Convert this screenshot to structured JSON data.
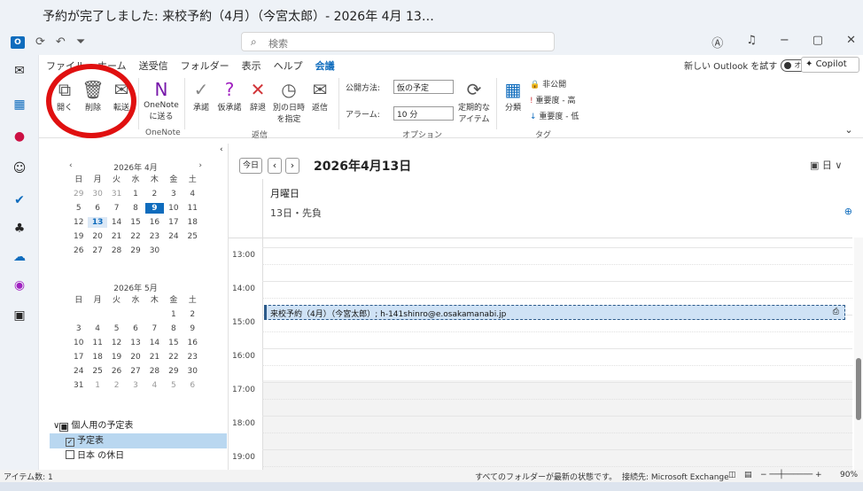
{
  "window": {
    "title": "予約が完了しました: 来校予約（4月）（今宮太郎）- 2026年 4月 13…",
    "search_placeholder": "検索"
  },
  "tabs": [
    "ファイル",
    "ホーム",
    "送受信",
    "フォルダー",
    "表示",
    "ヘルプ",
    "会議"
  ],
  "active_tab": "会議",
  "top_right": {
    "try_outlook": "新しい Outlook を試す",
    "toggle": "オフ",
    "copilot": "Copilot"
  },
  "ribbon": {
    "open": "開く",
    "delete": "削除",
    "forward": "転送",
    "onenote_send": "OneNote に送る",
    "onenote_group": "OneNote",
    "accept": "承諾",
    "tentative": "仮承諾",
    "decline": "辞退",
    "propose": "別の日時を指定",
    "reply": "返信",
    "respond_group": "返信",
    "show_as_label": "公開方法:",
    "show_as_value": "仮の予定",
    "reminder_label": "アラーム:",
    "reminder_value": "10 分",
    "recurring": "定期的なアイテム",
    "options_group": "オプション",
    "categorize": "分類",
    "private": "非公開",
    "high_importance": "重要度 - 高",
    "low_importance": "重要度 - 低",
    "tags_group": "タグ"
  },
  "mini_cal_april": {
    "title": "2026年 4月",
    "headers": [
      "日",
      "月",
      "火",
      "水",
      "木",
      "金",
      "土"
    ],
    "days": [
      "29",
      "30",
      "31",
      "1",
      "2",
      "3",
      "4",
      "5",
      "6",
      "7",
      "8",
      "9",
      "10",
      "11",
      "12",
      "13",
      "14",
      "15",
      "16",
      "17",
      "18",
      "19",
      "20",
      "21",
      "22",
      "23",
      "24",
      "25",
      "26",
      "27",
      "28",
      "29",
      "30"
    ]
  },
  "mini_cal_may": {
    "title": "2026年 5月",
    "headers": [
      "日",
      "月",
      "火",
      "水",
      "木",
      "金",
      "土"
    ],
    "days": [
      "1",
      "2",
      "3",
      "4",
      "5",
      "6",
      "7",
      "8",
      "9",
      "10",
      "11",
      "12",
      "13",
      "14",
      "15",
      "16",
      "17",
      "18",
      "19",
      "20",
      "21",
      "22",
      "23",
      "24",
      "25",
      "26",
      "27",
      "28",
      "29",
      "30",
      "31",
      "1",
      "2",
      "3",
      "4",
      "5",
      "6"
    ]
  },
  "calendar_list": {
    "group": "個人用の予定表",
    "items": [
      "予定表",
      "日本 の休日"
    ]
  },
  "main": {
    "today": "今日",
    "date_title": "2026年4月13日",
    "view": "日",
    "day_name": "月曜日",
    "day_sub": "13日・先負",
    "times": [
      "13:00",
      "14:00",
      "15:00",
      "16:00",
      "17:00",
      "18:00",
      "19:00"
    ],
    "event": "来校予約（4月）（今宮太郎）; h-141shinro@e.osakamanabi.jp"
  },
  "status": {
    "items": "アイテム数: 1",
    "sync": "すべてのフォルダーが最新の状態です。",
    "connection": "接続先: Microsoft Exchange",
    "zoom": "90%"
  },
  "colors": {
    "accent": "#0f6cbd",
    "annotation": "#e01010"
  }
}
